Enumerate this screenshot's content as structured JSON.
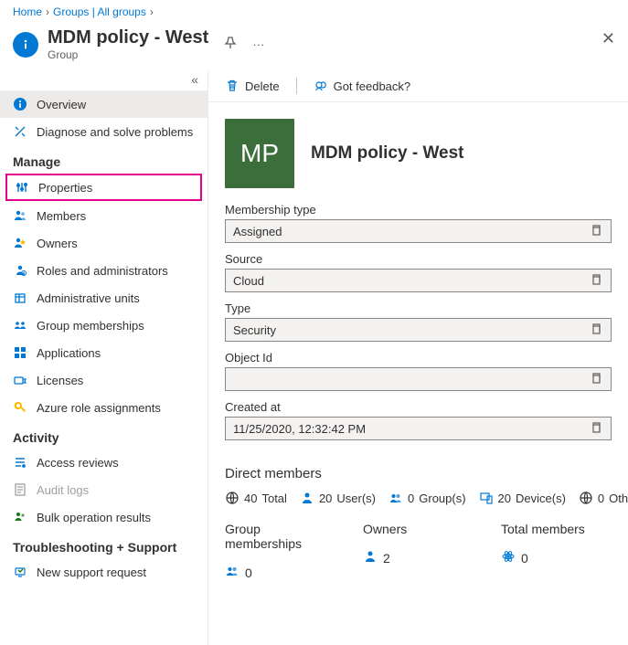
{
  "breadcrumb": [
    {
      "label": "Home"
    },
    {
      "label": "Groups | All groups"
    }
  ],
  "header": {
    "title": "MDM policy - West",
    "subtitle": "Group"
  },
  "sidebar": {
    "items": [
      {
        "label": "Overview",
        "icon": "info",
        "kind": "item",
        "active": true
      },
      {
        "label": "Diagnose and solve problems",
        "icon": "diagnose",
        "kind": "item"
      },
      {
        "label": "Manage",
        "kind": "section"
      },
      {
        "label": "Properties",
        "icon": "properties",
        "kind": "item",
        "highlight": true
      },
      {
        "label": "Members",
        "icon": "members",
        "kind": "item"
      },
      {
        "label": "Owners",
        "icon": "owners",
        "kind": "item"
      },
      {
        "label": "Roles and administrators",
        "icon": "roles",
        "kind": "item"
      },
      {
        "label": "Administrative units",
        "icon": "adminunits",
        "kind": "item"
      },
      {
        "label": "Group memberships",
        "icon": "groupmem",
        "kind": "item"
      },
      {
        "label": "Applications",
        "icon": "apps",
        "kind": "item"
      },
      {
        "label": "Licenses",
        "icon": "licenses",
        "kind": "item"
      },
      {
        "label": "Azure role assignments",
        "icon": "azurerole",
        "kind": "item"
      },
      {
        "label": "Activity",
        "kind": "section"
      },
      {
        "label": "Access reviews",
        "icon": "accessreviews",
        "kind": "item"
      },
      {
        "label": "Audit logs",
        "icon": "auditlogs",
        "kind": "item",
        "disabled": true
      },
      {
        "label": "Bulk operation results",
        "icon": "bulk",
        "kind": "item"
      },
      {
        "label": "Troubleshooting + Support",
        "kind": "section"
      },
      {
        "label": "New support request",
        "icon": "support",
        "kind": "item"
      }
    ]
  },
  "cmd": {
    "delete": "Delete",
    "feedback": "Got feedback?"
  },
  "group": {
    "initials": "MP",
    "name": "MDM policy - West",
    "fields": [
      {
        "label": "Membership type",
        "value": "Assigned"
      },
      {
        "label": "Source",
        "value": "Cloud"
      },
      {
        "label": "Type",
        "value": "Security"
      },
      {
        "label": "Object Id",
        "value": ""
      },
      {
        "label": "Created at",
        "value": "11/25/2020, 12:32:42 PM"
      }
    ]
  },
  "directMembers": {
    "heading": "Direct members",
    "stats": [
      {
        "icon": "globe",
        "num": "40",
        "text": "Total"
      },
      {
        "icon": "user-blue",
        "num": "20",
        "text": "User(s)"
      },
      {
        "icon": "group-blue",
        "num": "0",
        "text": "Group(s)"
      },
      {
        "icon": "device",
        "num": "20",
        "text": "Device(s)"
      },
      {
        "icon": "globe",
        "num": "0",
        "text": "Other(s)"
      }
    ]
  },
  "bottom": [
    {
      "label": "Group memberships",
      "icon": "group-blue",
      "value": "0"
    },
    {
      "label": "Owners",
      "icon": "user-blue",
      "value": "2"
    },
    {
      "label": "Total members",
      "icon": "atom",
      "value": "0"
    }
  ]
}
